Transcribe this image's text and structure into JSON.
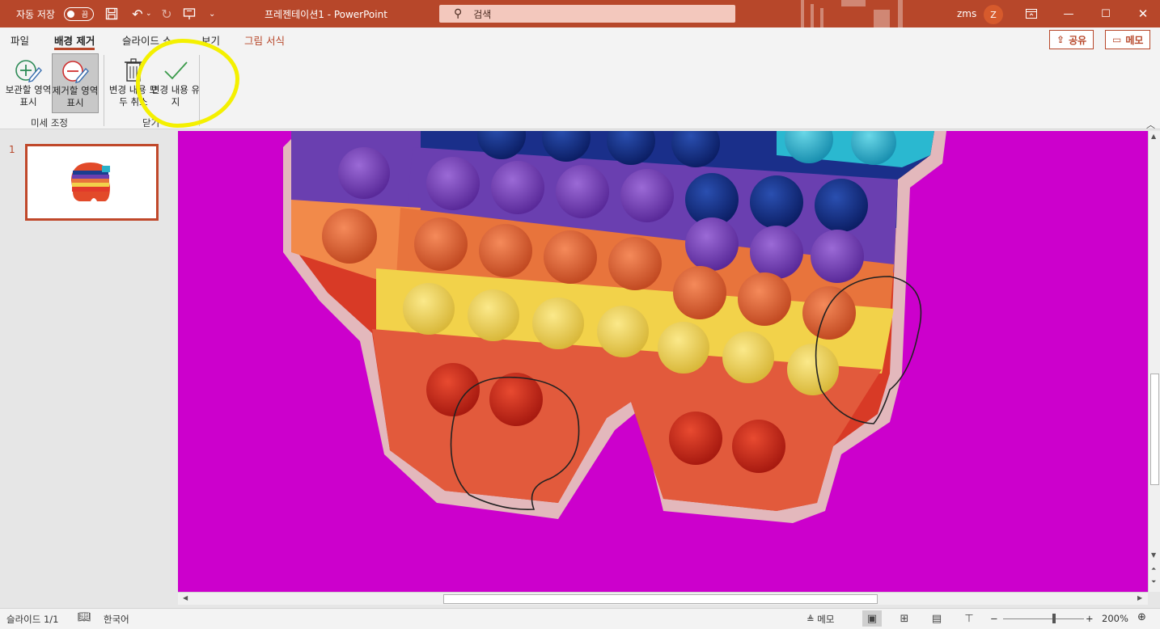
{
  "titlebar": {
    "autosave_label": "자동 저장",
    "autosave_state": "끔",
    "doc_title": "프레젠테이션1  -  PowerPoint",
    "search_placeholder": "검색",
    "user_name": "zms",
    "user_initial": "Z",
    "icons": [
      "save-icon",
      "undo-icon",
      "redo-icon",
      "present-icon",
      "customize-icon",
      "ribbon-display-icon",
      "minimize-icon",
      "maximize-icon",
      "close-icon"
    ]
  },
  "tabs": [
    {
      "label": "파일"
    },
    {
      "label": "배경 제거"
    },
    {
      "label": "슬라이드 쇼"
    },
    {
      "label": "보기"
    },
    {
      "label": "그림 서식"
    }
  ],
  "share_label": "공유",
  "memo_label": "메모",
  "ribbon": {
    "groups": [
      {
        "label": "미세 조정"
      },
      {
        "label": "닫기"
      }
    ],
    "buttons": [
      {
        "label": "보관할 영역 표시"
      },
      {
        "label": "제거할 영역 표시"
      },
      {
        "label": "변경 내용 모두 취소"
      },
      {
        "label": "변경 내용 유지"
      }
    ]
  },
  "slides": [
    {
      "number": "1"
    }
  ],
  "statusbar": {
    "slide_info": "슬라이드 1/1",
    "language": "한국어",
    "notes_label": "메모",
    "zoom": "200%"
  },
  "colors": {
    "accent": "#b7472a",
    "canvas_background": "#cc00cc",
    "highlight": "#f4f000"
  }
}
